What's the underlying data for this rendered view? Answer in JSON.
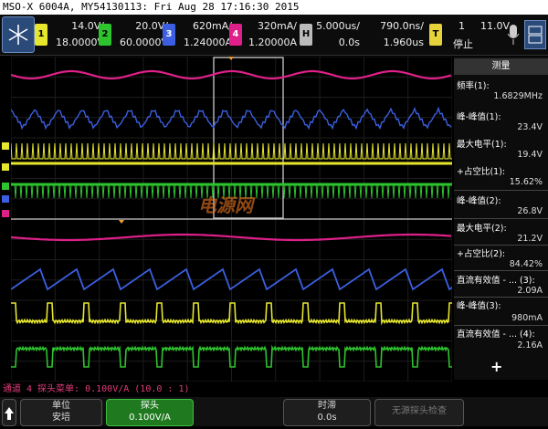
{
  "title": "MSO-X 6004A, MY54130113: Fri Aug 28 17:16:30 2015",
  "colors": {
    "ch1": "#e6e62e",
    "ch2": "#2ec42e",
    "ch3": "#3b5fe0",
    "ch4": "#e0208a",
    "accent": "#2a4a7a"
  },
  "toolbar": {
    "ch1": {
      "tag": "1",
      "scale": "14.0V/",
      "offset": "18.0000V"
    },
    "ch2": {
      "tag": "2",
      "scale": "20.0V/",
      "offset": "60.0000V"
    },
    "ch3": {
      "tag": "3",
      "scale": "620mA/",
      "offset": "1.24000A"
    },
    "ch4": {
      "tag": "4",
      "scale": "320mA/",
      "offset": "1.20000A"
    },
    "horiz": {
      "tag": "H",
      "scale": "5.000us/",
      "delay": "0.0s"
    },
    "zoom": {
      "scale": "790.0ns/",
      "delay": "1.960us"
    },
    "trigger": {
      "tag": "T",
      "mode": "1",
      "state": "停止",
      "level": "11.0V"
    }
  },
  "measurements": {
    "header": "测量",
    "items": [
      {
        "label": "频率(1):",
        "value": "1.6829MHz"
      },
      {
        "label": "峰-峰值(1):",
        "value": "23.4V"
      },
      {
        "label": "最大电平(1):",
        "value": "19.4V"
      },
      {
        "label": "+占空比(1):",
        "value": "15.62%"
      },
      {
        "label": "峰-峰值(2):",
        "value": "26.8V"
      },
      {
        "label": "最大电平(2):",
        "value": "21.2V"
      },
      {
        "label": "+占空比(2):",
        "value": "84.42%"
      },
      {
        "label": "直流有效值 - ... (3):",
        "value": "2.09A"
      },
      {
        "label": "峰-峰值(3):",
        "value": "980mA"
      },
      {
        "label": "直流有效值 - ... (4):",
        "value": "2.16A"
      }
    ],
    "add": "+"
  },
  "status": "通道 4 探头菜单: 0.100V/A (10.0 : 1)",
  "softkeys": {
    "unit": {
      "label": "单位",
      "value": "安培"
    },
    "probe": {
      "label": "探头",
      "value": "0.100V/A"
    },
    "skew": {
      "label": "时滞",
      "value": "0.0s"
    },
    "no_probe": {
      "label": "无源探头检查"
    }
  },
  "watermark": "电源网"
}
